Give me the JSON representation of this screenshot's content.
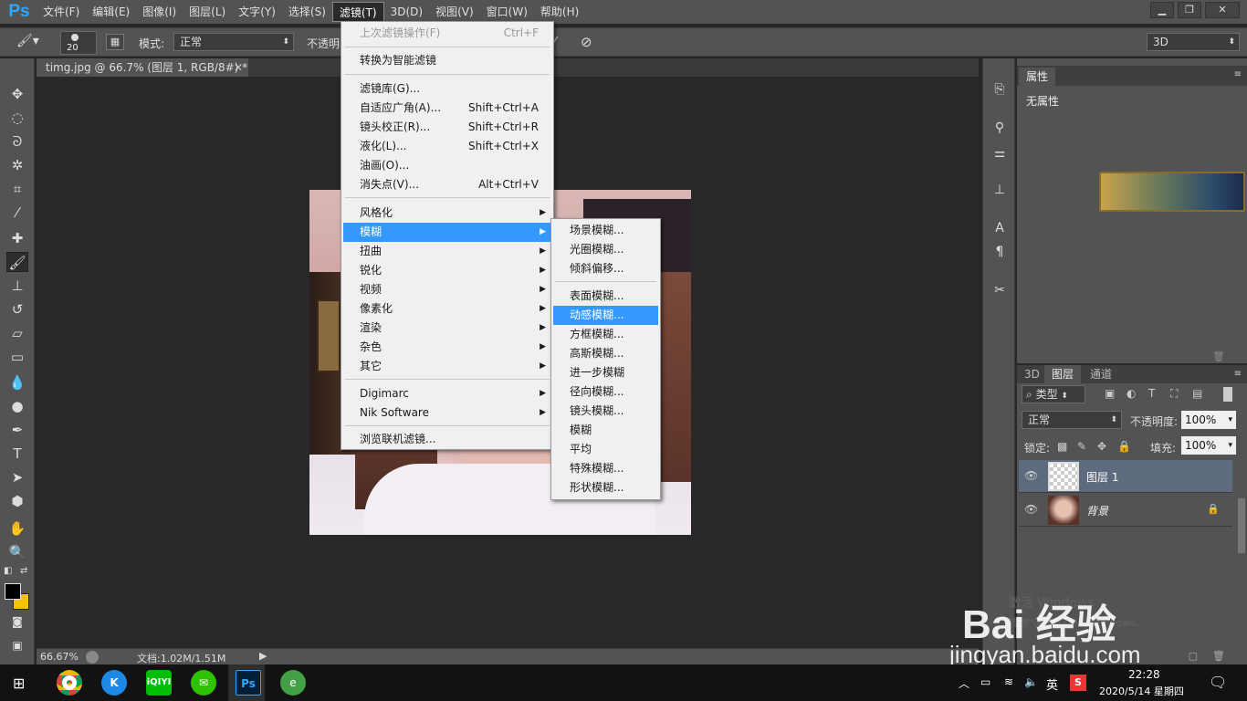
{
  "app": {
    "logo": "Ps"
  },
  "menubar": {
    "items": [
      "文件(F)",
      "编辑(E)",
      "图像(I)",
      "图层(L)",
      "文字(Y)",
      "选择(S)",
      "滤镜(T)",
      "3D(D)",
      "视图(V)",
      "窗口(W)",
      "帮助(H)"
    ],
    "active": "滤镜(T)"
  },
  "options": {
    "brush_size": "20",
    "mode_label": "模式:",
    "mode_value": "正常",
    "opacity_label": "不透明",
    "workspace": "3D"
  },
  "document": {
    "tab_title": "timg.jpg @ 66.7% (图层 1, RGB/8#) *",
    "zoom": "66.67%",
    "doc_size": "文档:1.02M/1.51M"
  },
  "filter_menu": {
    "last_filter": "上次滤镜操作(F)",
    "last_filter_sc": "Ctrl+F",
    "convert_smart": "转换为智能滤镜",
    "gallery": "滤镜库(G)...",
    "adaptive_wide": "自适应广角(A)...",
    "adaptive_wide_sc": "Shift+Ctrl+A",
    "lens_correction": "镜头校正(R)...",
    "lens_correction_sc": "Shift+Ctrl+R",
    "liquify": "液化(L)...",
    "liquify_sc": "Shift+Ctrl+X",
    "oil_paint": "油画(O)...",
    "vanishing_point": "消失点(V)...",
    "vanishing_point_sc": "Alt+Ctrl+V",
    "stylize": "风格化",
    "blur": "模糊",
    "distort": "扭曲",
    "sharpen": "锐化",
    "video": "视频",
    "pixelate": "像素化",
    "render": "渲染",
    "noise": "杂色",
    "other": "其它",
    "digimarc": "Digimarc",
    "nik": "Nik Software",
    "browse_online": "浏览联机滤镜..."
  },
  "blur_submenu": {
    "items": [
      "场景模糊...",
      "光圈模糊...",
      "倾斜偏移...",
      "表面模糊...",
      "动感模糊...",
      "方框模糊...",
      "高斯模糊...",
      "进一步模糊",
      "径向模糊...",
      "镜头模糊...",
      "模糊",
      "平均",
      "特殊模糊...",
      "形状模糊..."
    ],
    "highlighted": "动感模糊..."
  },
  "properties_panel": {
    "tab": "属性",
    "content": "无属性"
  },
  "layers_panel": {
    "tabs": [
      "3D",
      "图层",
      "通道"
    ],
    "active_tab": "图层",
    "filter_kind": "类型",
    "blend_mode": "正常",
    "opacity_label": "不透明度:",
    "opacity_value": "100%",
    "lock_label": "锁定:",
    "fill_label": "填充:",
    "fill_value": "100%",
    "layers": [
      {
        "name": "图层 1",
        "selected": true
      },
      {
        "name": "背景",
        "locked": true
      }
    ]
  },
  "watermark": {
    "activate_line1": "激活 Windows",
    "activate_line2": "转到\"设置\"以激活 Windows。",
    "brand": "Bai 经验",
    "url": "jingyan.baidu.com"
  },
  "taskbar": {
    "lang": "英",
    "time": "22:28",
    "date": "2020/5/14 星期四"
  },
  "colors": {
    "accent": "#3399ff",
    "ps_blue": "#31a8ff",
    "panel_bg": "#535353",
    "canvas_bg": "#282828"
  }
}
